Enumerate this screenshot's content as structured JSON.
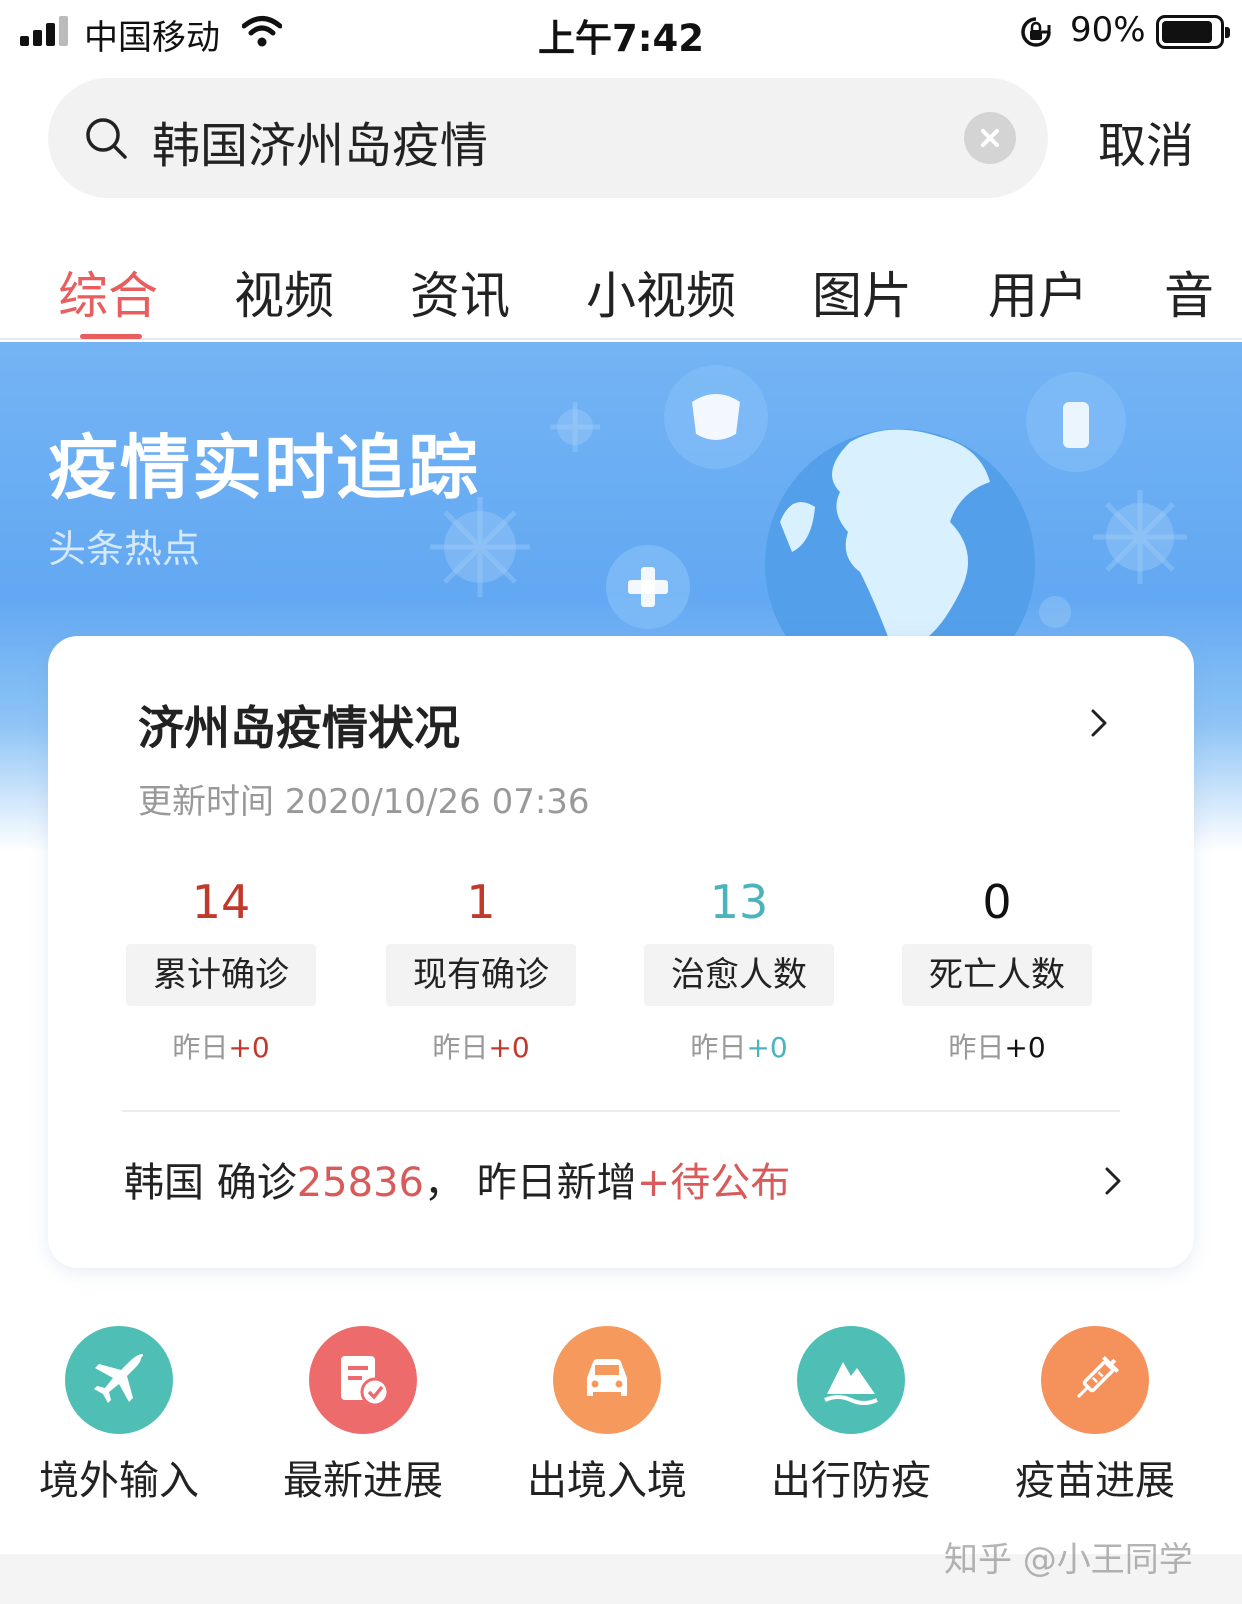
{
  "status_bar": {
    "carrier": "中国移动",
    "time": "上午7:42",
    "battery": "90%",
    "battery_level": 0.9
  },
  "search": {
    "query": "韩国济州岛疫情",
    "cancel_label": "取消"
  },
  "tabs": [
    {
      "label": "综合",
      "active": true
    },
    {
      "label": "视频"
    },
    {
      "label": "资讯"
    },
    {
      "label": "小视频"
    },
    {
      "label": "图片"
    },
    {
      "label": "用户"
    },
    {
      "label": "音"
    }
  ],
  "banner": {
    "title": "疫情实时追踪",
    "subtitle": "头条热点"
  },
  "card": {
    "title": "济州岛疫情状况",
    "update_time": "更新时间 2020/10/26 07:36",
    "stats": [
      {
        "value": "14",
        "label": "累计确诊",
        "delta_prefix": "昨日",
        "delta": "+0",
        "color": "#c0392b"
      },
      {
        "value": "1",
        "label": "现有确诊",
        "delta_prefix": "昨日",
        "delta": "+0",
        "color": "#c0392b"
      },
      {
        "value": "13",
        "label": "治愈人数",
        "delta_prefix": "昨日",
        "delta": "+0",
        "color": "#4bb3bd"
      },
      {
        "value": "0",
        "label": "死亡人数",
        "delta_prefix": "昨日",
        "delta": "+0",
        "color": "#111111"
      }
    ],
    "korea": {
      "country": "韩国",
      "confirmed_label": "确诊",
      "confirmed": "25836",
      "separator": "，",
      "new_label": "昨日新增",
      "new_value": "+待公布"
    }
  },
  "shortcuts": [
    {
      "label": "境外输入",
      "icon": "airplane-icon",
      "color": "#4fbfb5"
    },
    {
      "label": "最新进展",
      "icon": "document-check-icon",
      "color": "#ee6b6b"
    },
    {
      "label": "出境入境",
      "icon": "car-icon",
      "color": "#f59a5c"
    },
    {
      "label": "出行防疫",
      "icon": "mountain-icon",
      "color": "#4fbfb5"
    },
    {
      "label": "疫苗进展",
      "icon": "syringe-icon",
      "color": "#f5925c"
    }
  ],
  "watermark": "知乎 @小王同学",
  "colors": {
    "accent": "#e85d5d",
    "banner_blue": "#62a8f2",
    "teal": "#4bb3bd"
  }
}
